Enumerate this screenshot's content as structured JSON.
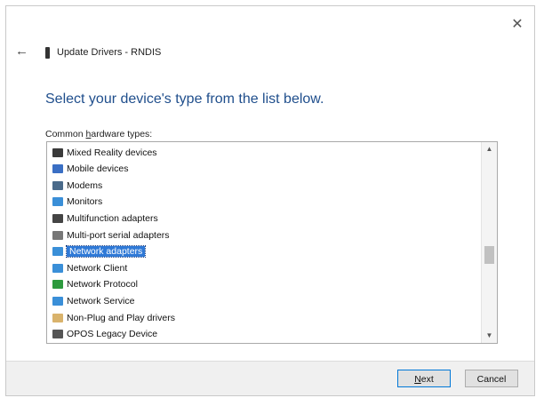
{
  "window": {
    "title": "Update Drivers - RNDIS",
    "close_glyph": "✕",
    "back_glyph": "←"
  },
  "main": {
    "heading": "Select your device's type from the list below.",
    "list_label_prefix": "Common ",
    "list_label_accel": "h",
    "list_label_suffix": "ardware types:"
  },
  "list": {
    "items": [
      {
        "label": "Mixed Reality devices",
        "icon": "headset-icon",
        "color": "#3a3a3a"
      },
      {
        "label": "Mobile devices",
        "icon": "mobile-device-icon",
        "color": "#3a6fc4"
      },
      {
        "label": "Modems",
        "icon": "modem-icon",
        "color": "#4a6a8a"
      },
      {
        "label": "Monitors",
        "icon": "monitor-icon",
        "color": "#3a8fd8"
      },
      {
        "label": "Multifunction adapters",
        "icon": "multifunction-adapter-icon",
        "color": "#444444"
      },
      {
        "label": "Multi-port serial adapters",
        "icon": "serial-adapter-icon",
        "color": "#777777"
      },
      {
        "label": "Network adapters",
        "icon": "network-adapter-icon",
        "color": "#3a8fd8",
        "selected": true
      },
      {
        "label": "Network Client",
        "icon": "network-client-icon",
        "color": "#3a8fd8"
      },
      {
        "label": "Network Protocol",
        "icon": "network-protocol-icon",
        "color": "#2e9a3e"
      },
      {
        "label": "Network Service",
        "icon": "network-service-icon",
        "color": "#3a8fd8"
      },
      {
        "label": "Non-Plug and Play drivers",
        "icon": "non-pnp-driver-icon",
        "color": "#d9b36c"
      },
      {
        "label": "OPOS Legacy Device",
        "icon": "opos-device-icon",
        "color": "#555555"
      }
    ],
    "selected_index": 6,
    "scroll_up_glyph": "▲",
    "scroll_down_glyph": "▼"
  },
  "footer": {
    "next_accel": "N",
    "next_rest": "ext",
    "cancel_label": "Cancel"
  },
  "colors": {
    "heading": "#1f4e8c",
    "selection": "#2f79d6"
  }
}
